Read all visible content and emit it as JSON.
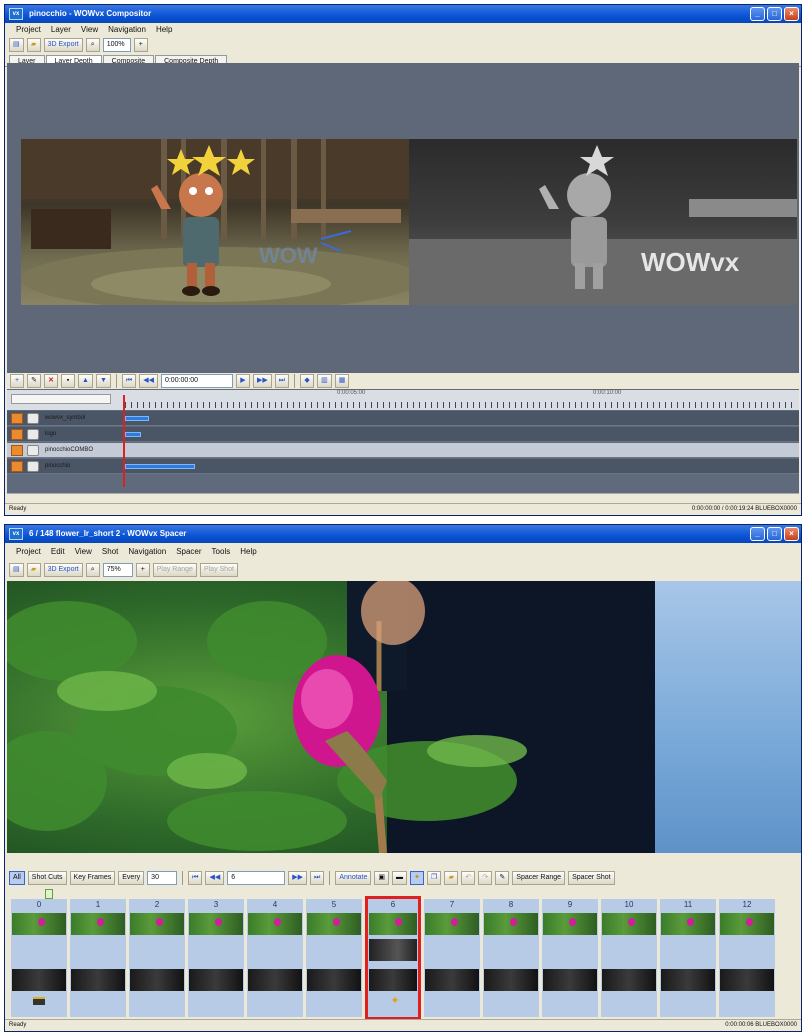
{
  "win1": {
    "title": "pinocchio - WOWvx Compositor",
    "menu": [
      "Project",
      "Layer",
      "View",
      "Navigation",
      "Help"
    ],
    "toolbar": {
      "export_label": "3D Export",
      "zoom": "100%"
    },
    "tabs": [
      "Layer",
      "Layer Depth",
      "Composite",
      "Composite Depth"
    ],
    "timeline": {
      "timecode": "0:00:00:00",
      "ruler_labels": [
        "0:00:05:00",
        "0:00:10:00"
      ],
      "layers": [
        {
          "name": "wowvx_symbol"
        },
        {
          "name": "logo"
        },
        {
          "name": "pinocchioCOMBO"
        },
        {
          "name": "pinocchio"
        }
      ]
    },
    "status_left": "Ready",
    "status_right": "0:00:00:00 / 0:00:19:24    BLUEBOX0000"
  },
  "win2": {
    "title": "6 / 148  flower_lr_short 2 - WOWvx Spacer",
    "menu": [
      "Project",
      "Edit",
      "View",
      "Shot",
      "Navigation",
      "Spacer",
      "Tools",
      "Help"
    ],
    "toolbar": {
      "export_label": "3D Export",
      "zoom": "75%",
      "play_range": "Play Range",
      "play_shot": "Play Shot"
    },
    "strip": {
      "all": "All",
      "shot_cuts": "Shot Cuts",
      "key_frames": "Key Frames",
      "every": "Every",
      "every_value": "30",
      "frame_field": "6",
      "annotate": "Annotate",
      "spacer_range": "Spacer Range",
      "spacer_shot": "Spacer Shot"
    },
    "frames": [
      "0",
      "1",
      "2",
      "3",
      "4",
      "5",
      "6",
      "7",
      "8",
      "9",
      "10",
      "11",
      "12"
    ],
    "selected_frame": "6",
    "status_left": "Ready",
    "status_right": "0:00:00:06    BLUEBOX0000"
  },
  "colors": {
    "title_bar": "#0a54d6",
    "selection": "#e02020",
    "timeline_bg": "#5f6b7c"
  }
}
